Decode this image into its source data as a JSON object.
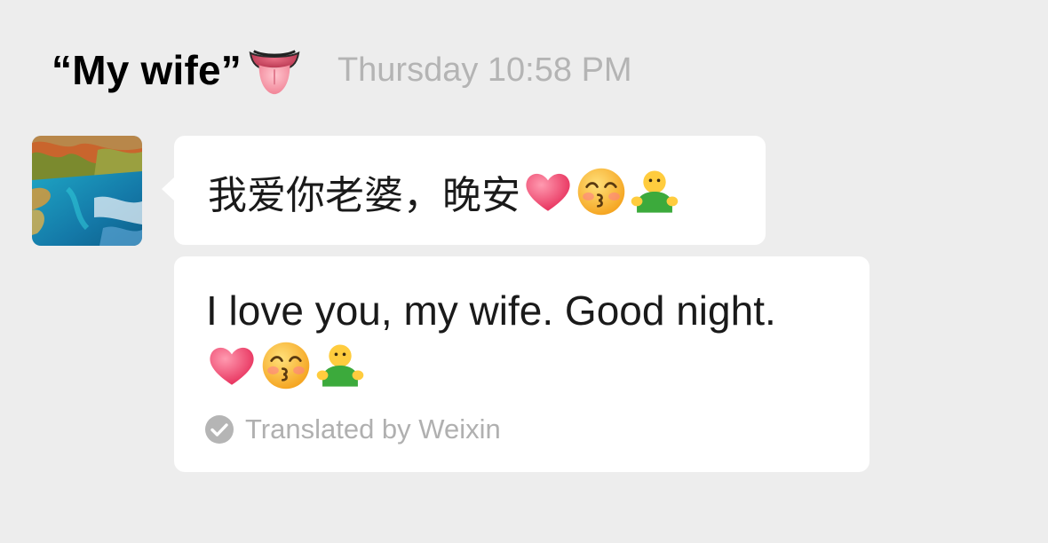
{
  "header": {
    "caption": "“My wife”",
    "caption_emoji": "tongue-face-icon",
    "timestamp": "Thursday 10:58 PM"
  },
  "message": {
    "avatar": "landscape-avatar",
    "original_text": "我爱你老婆，晚安",
    "original_emojis": [
      "heart-icon",
      "kissing-face-icon",
      "hugging-person-icon"
    ],
    "translation_text": "I love you, my wife. Good night.",
    "translation_emojis": [
      "heart-icon",
      "kissing-face-icon",
      "hugging-person-icon"
    ],
    "translated_by": "Translated by Weixin"
  },
  "colors": {
    "background": "#ededed",
    "bubble": "#ffffff",
    "timestamp": "#b4b4b4",
    "translated_by": "#b0b0b0",
    "heart": "#f2557a",
    "emoji_face": "#ffc83d",
    "hug_shirt": "#3caa3c"
  }
}
